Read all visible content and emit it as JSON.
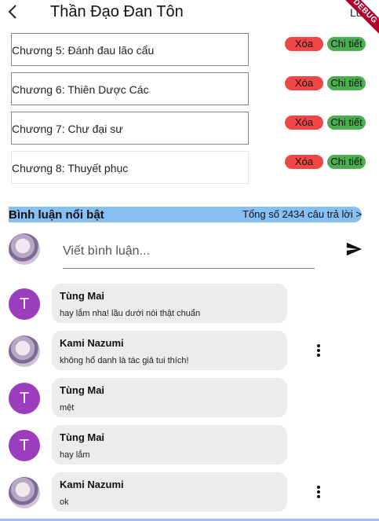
{
  "appbar": {
    "title": "Thần Đạo Đan Tôn",
    "save_label": "Lưu",
    "debug_label": "DEBUG"
  },
  "chapters": [
    {
      "label": "Chương 5: Đánh đau lão cẩu",
      "delete_label": "Xóa",
      "detail_label": "Chi tiết"
    },
    {
      "label": "Chương 6: Thiên Dược Các",
      "delete_label": "Xóa",
      "detail_label": "Chi tiết"
    },
    {
      "label": "Chương 7: Chư đại sư",
      "delete_label": "Xóa",
      "detail_label": "Chi tiết"
    },
    {
      "label": "Chương 8: Thuyết phục",
      "delete_label": "Xóa",
      "detail_label": "Chi tiết"
    }
  ],
  "comments_section": {
    "title": "Bình luận nổi bật",
    "total_label": "Tổng số 2434 câu trả lời >",
    "input_placeholder": "Viết bình luận..."
  },
  "comments": [
    {
      "avatar": "letter",
      "initial": "T",
      "name": "Tùng Mai",
      "text": "hay lắm nha! lầu dưới nói thật chuẩn",
      "has_menu": false
    },
    {
      "avatar": "anime",
      "initial": "",
      "name": "Kami Nazumi",
      "text": "không hổ danh là tác giả tui thích!",
      "has_menu": true
    },
    {
      "avatar": "letter",
      "initial": "T",
      "name": "Tùng Mai",
      "text": "mệt",
      "has_menu": false
    },
    {
      "avatar": "letter",
      "initial": "T",
      "name": "Tùng Mai",
      "text": "hay lắm",
      "has_menu": false
    },
    {
      "avatar": "anime",
      "initial": "",
      "name": "Kami Nazumi",
      "text": "ok",
      "has_menu": true
    }
  ],
  "colors": {
    "delete": "#ef4646",
    "detail": "#4cae50",
    "header_band": "#87bff2",
    "avatar_letter": "#9c3dbd"
  }
}
